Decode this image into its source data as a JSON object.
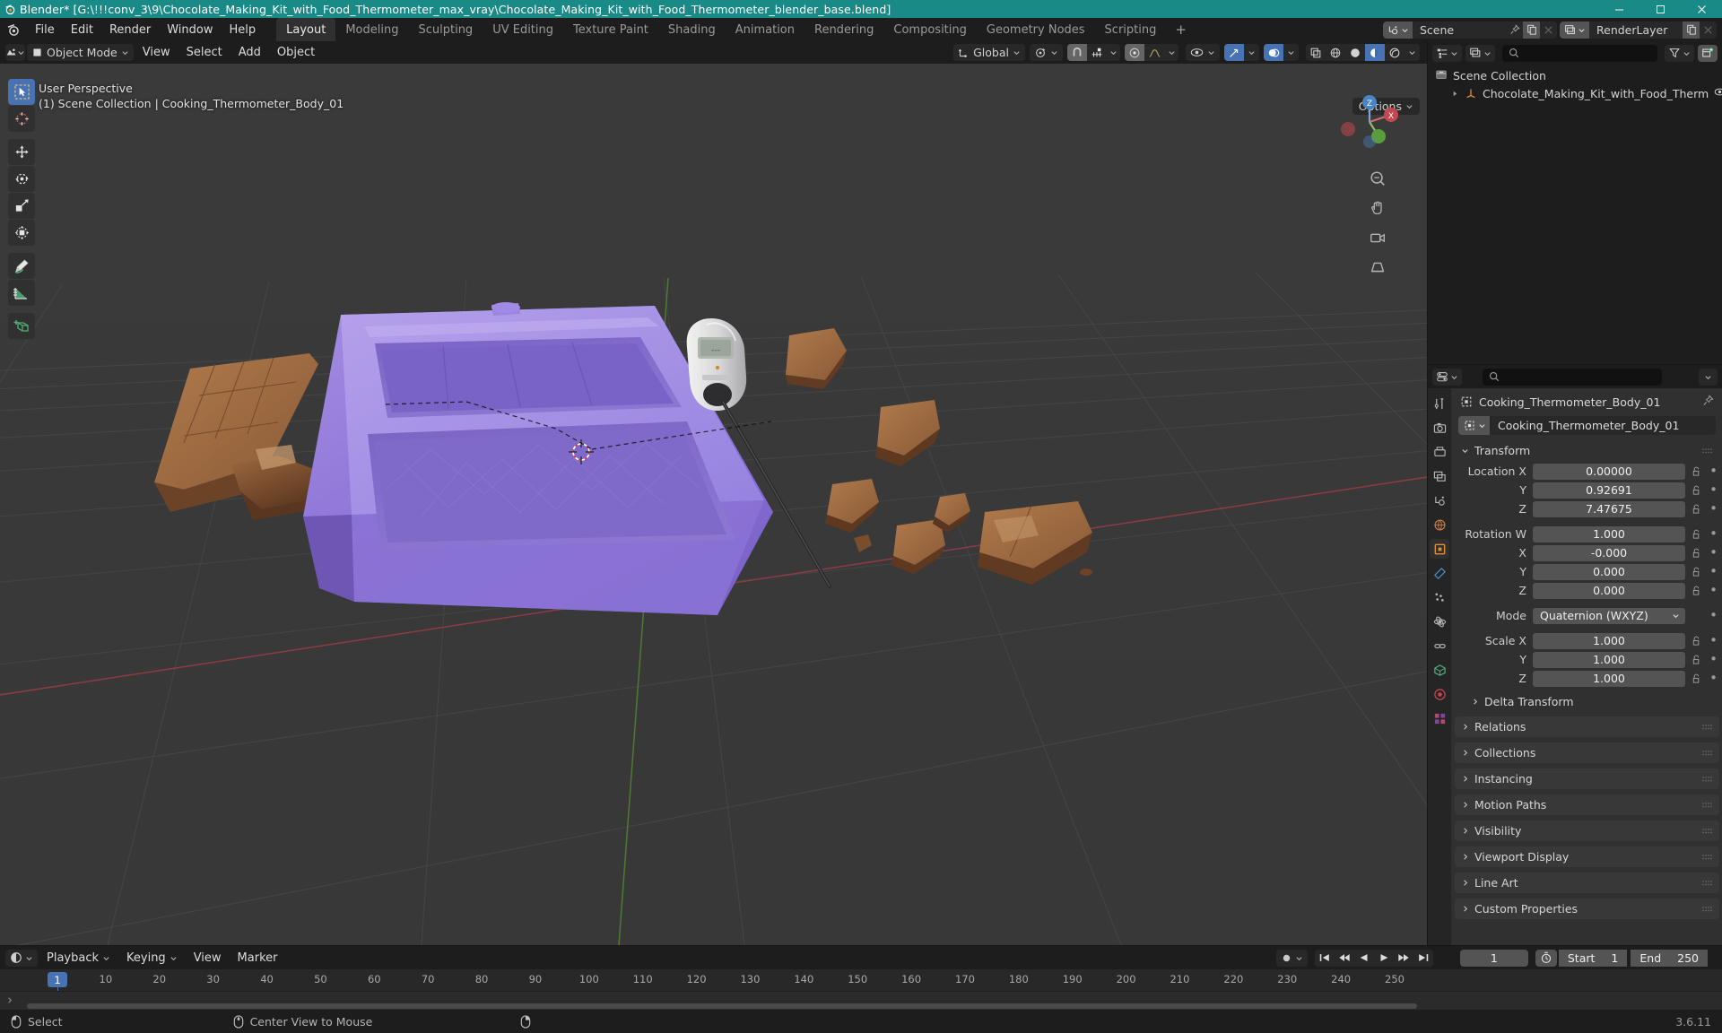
{
  "titlebar": {
    "text": "Blender* [G:\\!!!conv_3\\9\\Chocolate_Making_Kit_with_Food_Thermometer_max_vray\\Chocolate_Making_Kit_with_Food_Thermometer_blender_base.blend]",
    "minimize": "minimize-icon",
    "maximize": "maximize-icon",
    "close": "close-icon",
    "accent_color": "#1a8a87"
  },
  "topbar": {
    "menus": [
      "File",
      "Edit",
      "Render",
      "Window",
      "Help"
    ],
    "workspaces": [
      "Layout",
      "Modeling",
      "Sculpting",
      "UV Editing",
      "Texture Paint",
      "Shading",
      "Animation",
      "Rendering",
      "Compositing",
      "Geometry Nodes",
      "Scripting"
    ],
    "active_workspace": "Layout",
    "add_workspace": "+",
    "scene_name": "Scene",
    "viewlayer_name": "RenderLayer"
  },
  "viewport": {
    "mode": "Object Mode",
    "menus": [
      "View",
      "Select",
      "Add",
      "Object"
    ],
    "transform_orientation": "Global",
    "options_label": "Options",
    "overlay_line1": "User Perspective",
    "overlay_line2": "(1) Scene Collection | Cooking_Thermometer_Body_01",
    "tools": [
      "select-box-tool",
      "cursor-tool",
      "move-tool",
      "rotate-tool",
      "scale-tool",
      "transform-tool",
      "annotate-tool",
      "measure-tool",
      "add-cube-tool"
    ],
    "active_tool": "select-box-tool",
    "gizmo_axes": [
      "X",
      "Y",
      "Z"
    ],
    "nav_buttons": [
      "zoom-icon",
      "pan-icon",
      "camera-icon",
      "ortho-persp-icon"
    ]
  },
  "outliner": {
    "search_placeholder": "",
    "display_mode": "view-layer-icon",
    "filter": "filter-icon",
    "new_collection": "new-collection-icon",
    "rows": [
      {
        "label": "Scene Collection",
        "icon": "collection-icon",
        "indent": false
      },
      {
        "label": "Chocolate_Making_Kit_with_Food_Therm",
        "icon": "empty-axes-icon",
        "indent": true
      }
    ]
  },
  "properties": {
    "search_placeholder": "",
    "breadcrumb": "Cooking_Thermometer_Body_01",
    "object_name": "Cooking_Thermometer_Body_01",
    "tabs": [
      "tool-icon",
      "render-icon",
      "output-icon",
      "view-layer-icon",
      "scene-icon",
      "world-icon",
      "object-icon",
      "modifier-icon",
      "particles-icon",
      "physics-icon",
      "constraints-icon",
      "data-icon",
      "material-icon",
      "texture-icon"
    ],
    "active_tab_index": 6,
    "transform": {
      "title": "Transform",
      "location_label": "Location X",
      "rotation_label": "Rotation W",
      "scale_label": "Scale X",
      "mode_label": "Mode",
      "mode_value": "Quaternion (WXYZ)",
      "location": {
        "x": "0.00000",
        "y": "0.92691",
        "z": "7.47675"
      },
      "rotation": {
        "w": "1.000",
        "x": "-0.000",
        "y": "0.000",
        "z": "0.000"
      },
      "scale": {
        "x": "1.000",
        "y": "1.000",
        "z": "1.000"
      },
      "axis_labels": [
        "X",
        "Y",
        "Z",
        "W"
      ],
      "delta_transform": "Delta Transform"
    },
    "panels": [
      "Relations",
      "Collections",
      "Instancing",
      "Motion Paths",
      "Visibility",
      "Viewport Display",
      "Line Art",
      "Custom Properties"
    ]
  },
  "timeline": {
    "menus": [
      "Playback",
      "Keying",
      "View",
      "Marker"
    ],
    "current_frame": "1",
    "start_label": "Start",
    "start_value": "1",
    "end_label": "End",
    "end_value": "250",
    "playhead_frame": "1",
    "ticks": [
      10,
      20,
      30,
      40,
      50,
      60,
      70,
      80,
      90,
      100,
      110,
      120,
      130,
      140,
      150,
      160,
      170,
      180,
      190,
      200,
      210,
      220,
      230,
      240,
      250
    ]
  },
  "statusbar": {
    "items": [
      "Select",
      "Center View to Mouse",
      ""
    ],
    "version": "3.6.11"
  }
}
